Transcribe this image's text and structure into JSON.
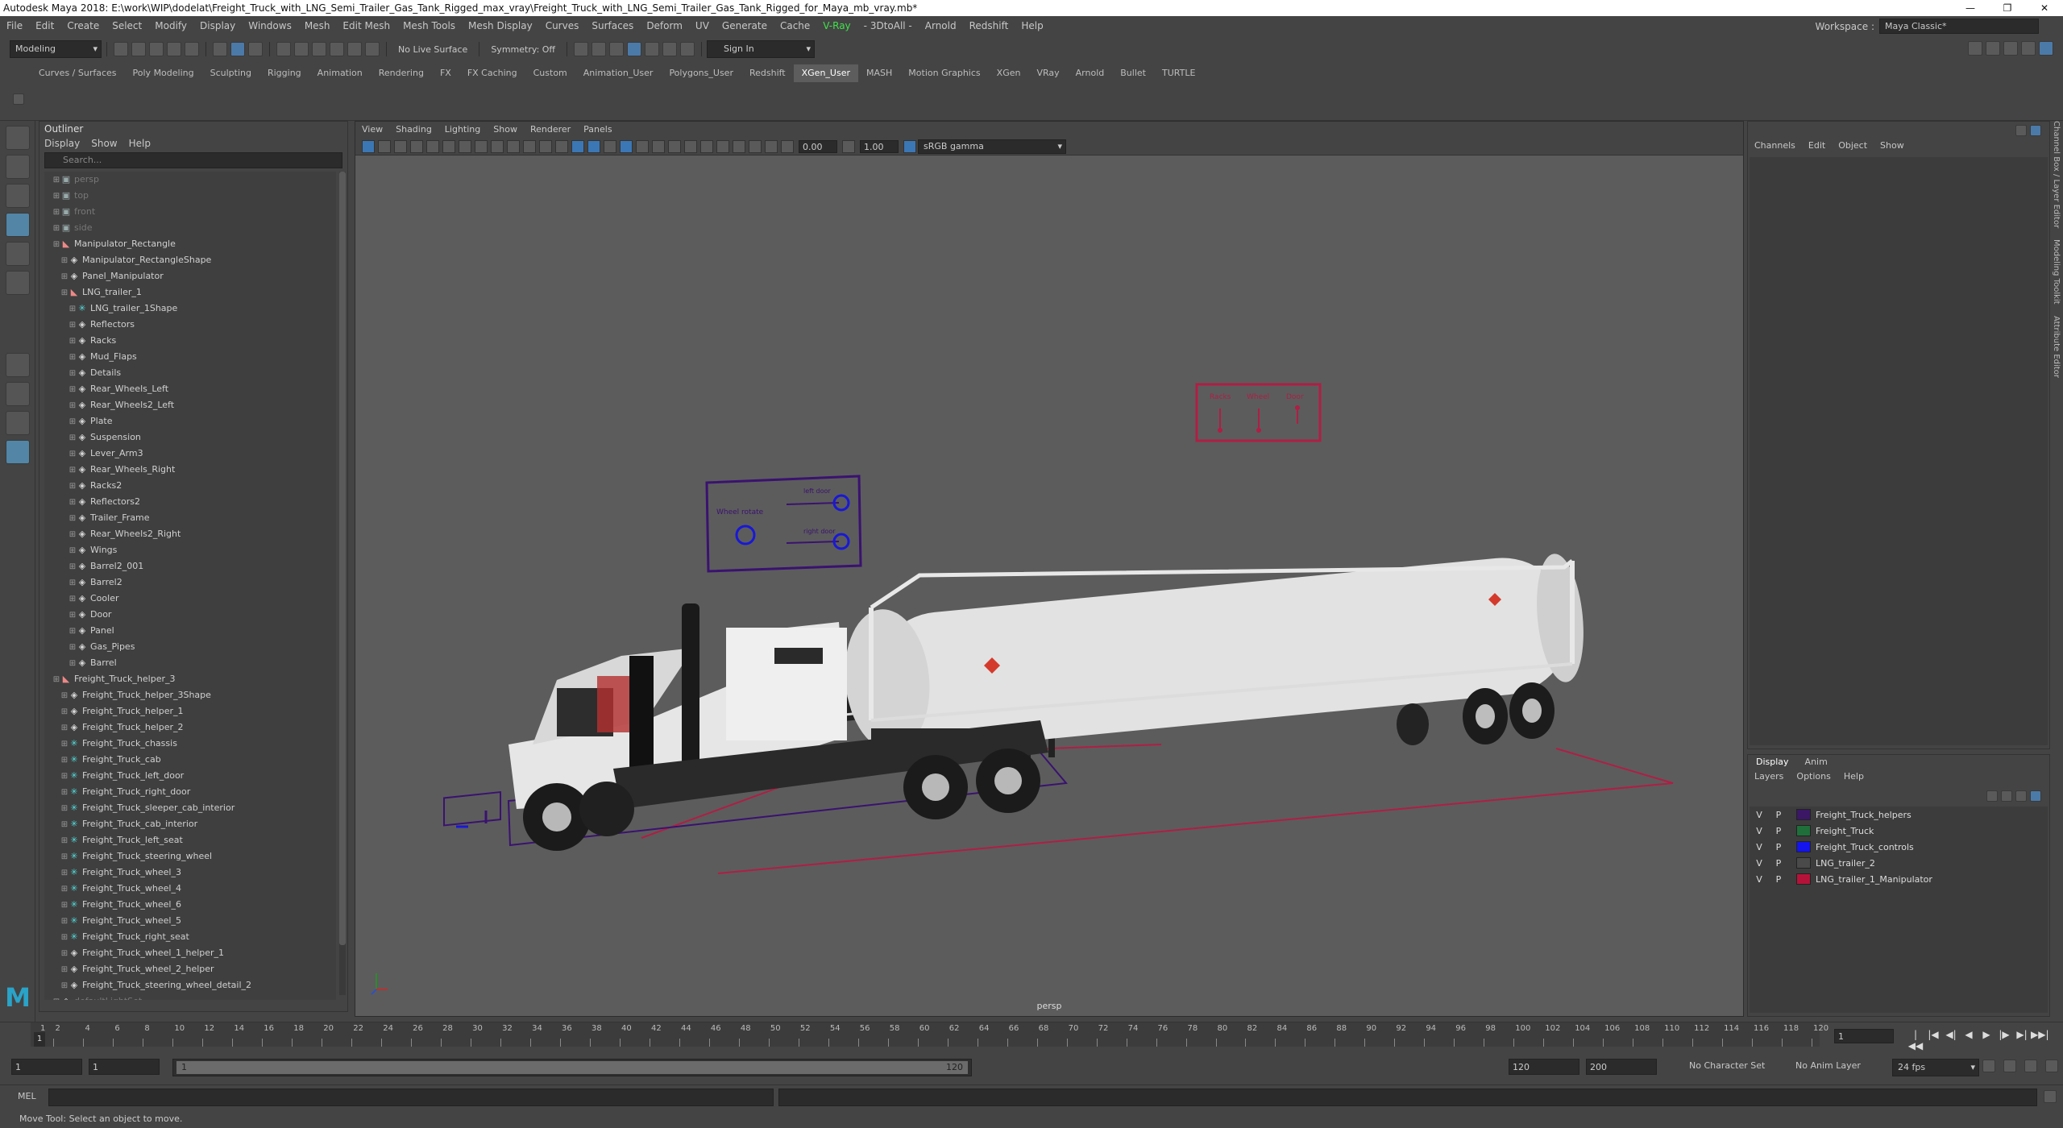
{
  "app": {
    "title": "Autodesk Maya 2018: E:\\work\\WIP\\dodelat\\Freight_Truck_with_LNG_Semi_Trailer_Gas_Tank_Rigged_max_vray\\Freight_Truck_with_LNG_Semi_Trailer_Gas_Tank_Rigged_for_Maya_mb_vray.mb*",
    "win_min": "—",
    "win_max": "❐",
    "win_close": "✕"
  },
  "menubar": {
    "items": [
      "File",
      "Edit",
      "Create",
      "Select",
      "Modify",
      "Display",
      "Windows",
      "Mesh",
      "Edit Mesh",
      "Mesh Tools",
      "Mesh Display",
      "Curves",
      "Surfaces",
      "Deform",
      "UV",
      "Generate",
      "Cache"
    ],
    "vray": "V-Ray",
    "items2": [
      "- 3DtoAll -",
      "Arnold",
      "Redshift",
      "Help"
    ],
    "workspace_label": "Workspace :",
    "workspace_value": "Maya Classic*"
  },
  "statusline": {
    "mode": "Modeling",
    "live_surface": "No Live Surface",
    "symmetry": "Symmetry: Off",
    "sign_in": "Sign In"
  },
  "shelf": {
    "tabs": [
      "Curves / Surfaces",
      "Poly Modeling",
      "Sculpting",
      "Rigging",
      "Animation",
      "Rendering",
      "FX",
      "FX Caching",
      "Custom",
      "Animation_User",
      "Polygons_User",
      "Redshift",
      "XGen_User",
      "MASH",
      "Motion Graphics",
      "XGen",
      "VRay",
      "Arnold",
      "Bullet",
      "TURTLE"
    ],
    "active": "XGen_User"
  },
  "outliner": {
    "title": "Outliner",
    "menus": [
      "Display",
      "Show",
      "Help"
    ],
    "search_placeholder": "Search...",
    "items": [
      {
        "label": "persp",
        "indent": 1,
        "icon": "cam",
        "dim": true
      },
      {
        "label": "top",
        "indent": 1,
        "icon": "cam",
        "dim": true
      },
      {
        "label": "front",
        "indent": 1,
        "icon": "cam",
        "dim": true
      },
      {
        "label": "side",
        "indent": 1,
        "icon": "cam",
        "dim": true
      },
      {
        "label": "Manipulator_Rectangle",
        "indent": 1,
        "icon": "lns"
      },
      {
        "label": "Manipulator_RectangleShape",
        "indent": 2,
        "icon": "grp"
      },
      {
        "label": "Panel_Manipulator",
        "indent": 2,
        "icon": "grp"
      },
      {
        "label": "LNG_trailer_1",
        "indent": 2,
        "icon": "lns"
      },
      {
        "label": "LNG_trailer_1Shape",
        "indent": 3,
        "icon": "cross"
      },
      {
        "label": "Reflectors",
        "indent": 3,
        "icon": "grp"
      },
      {
        "label": "Racks",
        "indent": 3,
        "icon": "grp"
      },
      {
        "label": "Mud_Flaps",
        "indent": 3,
        "icon": "grp"
      },
      {
        "label": "Details",
        "indent": 3,
        "icon": "grp"
      },
      {
        "label": "Rear_Wheels_Left",
        "indent": 3,
        "icon": "grp"
      },
      {
        "label": "Rear_Wheels2_Left",
        "indent": 3,
        "icon": "grp"
      },
      {
        "label": "Plate",
        "indent": 3,
        "icon": "grp"
      },
      {
        "label": "Suspension",
        "indent": 3,
        "icon": "grp"
      },
      {
        "label": "Lever_Arm3",
        "indent": 3,
        "icon": "grp"
      },
      {
        "label": "Rear_Wheels_Right",
        "indent": 3,
        "icon": "grp"
      },
      {
        "label": "Racks2",
        "indent": 3,
        "icon": "grp"
      },
      {
        "label": "Reflectors2",
        "indent": 3,
        "icon": "grp"
      },
      {
        "label": "Trailer_Frame",
        "indent": 3,
        "icon": "grp"
      },
      {
        "label": "Rear_Wheels2_Right",
        "indent": 3,
        "icon": "grp"
      },
      {
        "label": "Wings",
        "indent": 3,
        "icon": "grp"
      },
      {
        "label": "Barrel2_001",
        "indent": 3,
        "icon": "grp"
      },
      {
        "label": "Barrel2",
        "indent": 3,
        "icon": "grp"
      },
      {
        "label": "Cooler",
        "indent": 3,
        "icon": "grp"
      },
      {
        "label": "Door",
        "indent": 3,
        "icon": "grp"
      },
      {
        "label": "Panel",
        "indent": 3,
        "icon": "grp"
      },
      {
        "label": "Gas_Pipes",
        "indent": 3,
        "icon": "grp"
      },
      {
        "label": "Barrel",
        "indent": 3,
        "icon": "grp"
      },
      {
        "label": "Freight_Truck_helper_3",
        "indent": 1,
        "icon": "lns"
      },
      {
        "label": "Freight_Truck_helper_3Shape",
        "indent": 2,
        "icon": "grp"
      },
      {
        "label": "Freight_Truck_helper_1",
        "indent": 2,
        "icon": "grp"
      },
      {
        "label": "Freight_Truck_helper_2",
        "indent": 2,
        "icon": "grp"
      },
      {
        "label": "Freight_Truck_chassis",
        "indent": 2,
        "icon": "cross"
      },
      {
        "label": "Freight_Truck_cab",
        "indent": 2,
        "icon": "cross"
      },
      {
        "label": "Freight_Truck_left_door",
        "indent": 2,
        "icon": "cross"
      },
      {
        "label": "Freight_Truck_right_door",
        "indent": 2,
        "icon": "cross"
      },
      {
        "label": "Freight_Truck_sleeper_cab_interior",
        "indent": 2,
        "icon": "cross"
      },
      {
        "label": "Freight_Truck_cab_interior",
        "indent": 2,
        "icon": "cross"
      },
      {
        "label": "Freight_Truck_left_seat",
        "indent": 2,
        "icon": "cross"
      },
      {
        "label": "Freight_Truck_steering_wheel",
        "indent": 2,
        "icon": "cross"
      },
      {
        "label": "Freight_Truck_wheel_3",
        "indent": 2,
        "icon": "cross"
      },
      {
        "label": "Freight_Truck_wheel_4",
        "indent": 2,
        "icon": "cross"
      },
      {
        "label": "Freight_Truck_wheel_6",
        "indent": 2,
        "icon": "cross"
      },
      {
        "label": "Freight_Truck_wheel_5",
        "indent": 2,
        "icon": "cross"
      },
      {
        "label": "Freight_Truck_right_seat",
        "indent": 2,
        "icon": "cross"
      },
      {
        "label": "Freight_Truck_wheel_1_helper_1",
        "indent": 2,
        "icon": "grp"
      },
      {
        "label": "Freight_Truck_wheel_2_helper",
        "indent": 2,
        "icon": "grp"
      },
      {
        "label": "Freight_Truck_steering_wheel_detail_2",
        "indent": 2,
        "icon": "grp"
      },
      {
        "label": "defaultLightSet",
        "indent": 1,
        "icon": "grp",
        "dim": true
      }
    ]
  },
  "viewport": {
    "menus": [
      "View",
      "Shading",
      "Lighting",
      "Show",
      "Renderer",
      "Panels"
    ],
    "exposure": "0.00",
    "gamma": "1.00",
    "color_space": "sRGB gamma",
    "camera_label": "persp",
    "controls_panel1": {
      "wheel_rotate": "Wheel rotate",
      "left_door": "left door",
      "right_door": "right door"
    },
    "controls_panel2": {
      "racks": "Racks",
      "wheel": "Wheel",
      "door": "Door"
    },
    "colors": {
      "manip_red": "#b01e45",
      "helper_purple": "#3a1270",
      "control_blue": "#1818d8",
      "tank": "#e6e6e6",
      "bg": "#5c5c5c"
    }
  },
  "channelbox": {
    "menus": [
      "Channels",
      "Edit",
      "Object",
      "Show"
    ]
  },
  "layereditor": {
    "tabs": [
      "Display",
      "Anim"
    ],
    "menus": [
      "Layers",
      "Options",
      "Help"
    ],
    "layers": [
      {
        "v": "V",
        "p": "P",
        "name": "Freight_Truck_helpers",
        "color": "#3b1766"
      },
      {
        "v": "V",
        "p": "P",
        "name": "Freight_Truck",
        "color": "#1f6f3a"
      },
      {
        "v": "V",
        "p": "P",
        "name": "Freight_Truck_controls",
        "color": "#1414ee"
      },
      {
        "v": "V",
        "p": "P",
        "name": "LNG_trailer_2",
        "color": "#4a4a4a"
      },
      {
        "v": "V",
        "p": "P",
        "name": "LNG_trailer_1_Manipulator",
        "color": "#b5123a"
      }
    ]
  },
  "sidetabs": [
    "Channel Box / Layer Editor",
    "Modeling Toolkit",
    "Attribute Editor"
  ],
  "timeslider": {
    "ticks": [
      "1",
      "2",
      "4",
      "6",
      "8",
      "10",
      "12",
      "14",
      "16",
      "18",
      "20",
      "22",
      "24",
      "26",
      "28",
      "30",
      "32",
      "34",
      "36",
      "38",
      "40",
      "42",
      "44",
      "46",
      "48",
      "50",
      "52",
      "54",
      "56",
      "58",
      "60",
      "62",
      "64",
      "66",
      "68",
      "70",
      "72",
      "74",
      "76",
      "78",
      "80",
      "82",
      "84",
      "86",
      "88",
      "90",
      "92",
      "94",
      "96",
      "98",
      "100",
      "102",
      "104",
      "106",
      "108",
      "110",
      "112",
      "114",
      "116",
      "118",
      "120"
    ],
    "current_frame_left": "1",
    "current_frame": "1",
    "play_buttons": [
      "|◀◀",
      "|◀",
      "◀|",
      "◀",
      "▶",
      "|▶",
      "▶|",
      "▶▶|"
    ]
  },
  "rangeslider": {
    "start": "1",
    "playback_start": "1",
    "range_start": "1",
    "range_end": "120",
    "playback_end": "120",
    "end": "200",
    "character_set": "No Character Set",
    "anim_layer": "No Anim Layer",
    "fps": "24 fps"
  },
  "cmdline": {
    "label": "MEL"
  },
  "helpline": {
    "text": "Move Tool: Select an object to move."
  }
}
